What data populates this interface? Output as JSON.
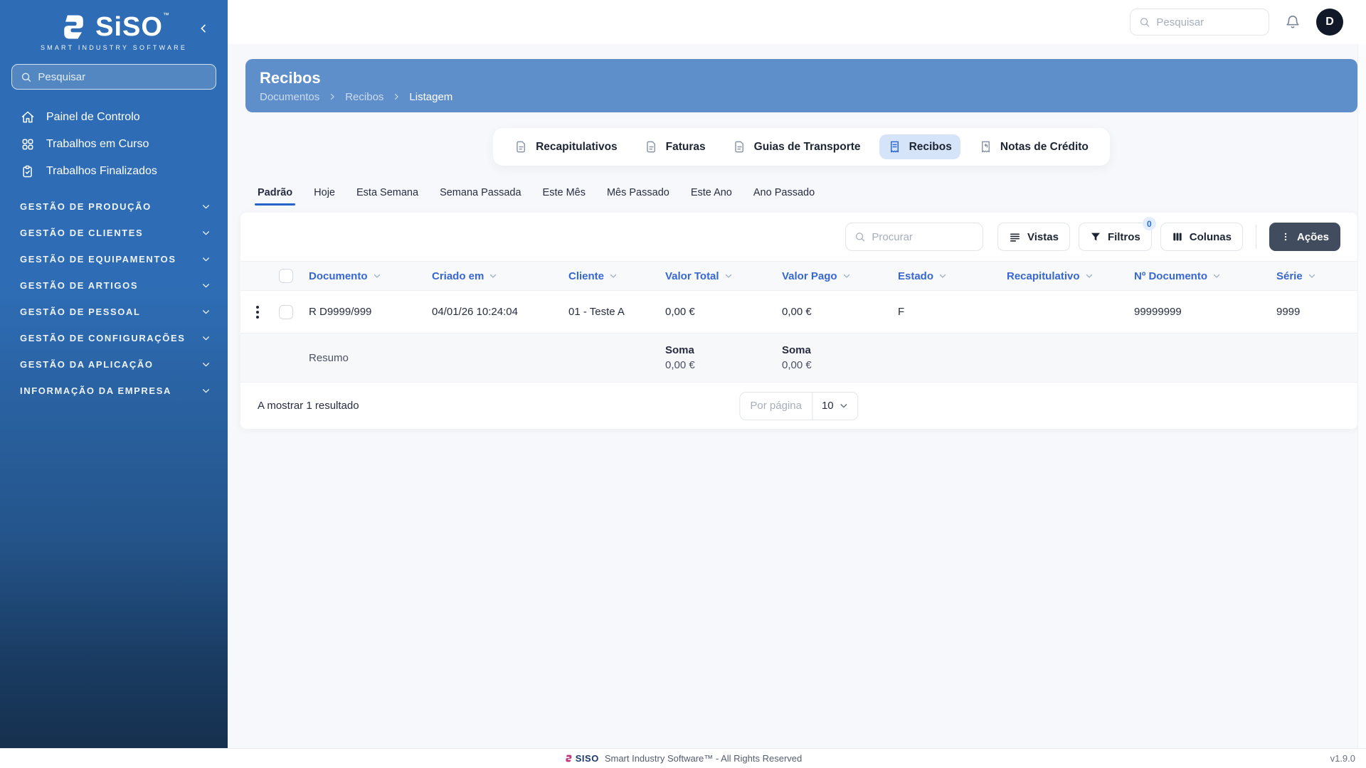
{
  "app": {
    "name": "SiSO",
    "tm": "™",
    "tagline": "SMART INDUSTRY SOFTWARE",
    "footer_brand": "SISO",
    "footer_text": "Smart Industry Software™ - All Rights Reserved",
    "version": "v1.9.0"
  },
  "colors": {
    "accent_blue": "#2f6bd0",
    "sidebar_top": "#2e6db5",
    "sidebar_bottom": "#16304e",
    "banner": "#5e8fca",
    "actions_button": "#414d5f",
    "active_tab_bg": "#d5e4f8"
  },
  "sidebar": {
    "search_placeholder": "Pesquisar",
    "items": [
      {
        "label": "Painel de Controlo",
        "icon": "home"
      },
      {
        "label": "Trabalhos em Curso",
        "icon": "grid"
      },
      {
        "label": "Trabalhos Finalizados",
        "icon": "clipboard-check"
      }
    ],
    "sections": [
      "GESTÃO DE PRODUÇÃO",
      "GESTÃO DE CLIENTES",
      "GESTÃO DE EQUIPAMENTOS",
      "GESTÃO DE ARTIGOS",
      "GESTÃO DE PESSOAL",
      "GESTÃO DE CONFIGURAÇÕES",
      "GESTÃO DA APLICAÇÃO",
      "INFORMAÇÃO DA EMPRESA"
    ]
  },
  "topbar": {
    "search_placeholder": "Pesquisar",
    "avatar_initial": "D"
  },
  "header": {
    "title": "Recibos",
    "breadcrumb": [
      "Documentos",
      "Recibos",
      "Listagem"
    ]
  },
  "doc_tabs": [
    {
      "label": "Recapitulativos",
      "active": false
    },
    {
      "label": "Faturas",
      "active": false
    },
    {
      "label": "Guias de Transporte",
      "active": false
    },
    {
      "label": "Recibos",
      "active": true
    },
    {
      "label": "Notas de Crédito",
      "active": false
    }
  ],
  "filter_tabs": [
    {
      "label": "Padrão",
      "active": true
    },
    {
      "label": "Hoje",
      "active": false
    },
    {
      "label": "Esta Semana",
      "active": false
    },
    {
      "label": "Semana Passada",
      "active": false
    },
    {
      "label": "Este Mês",
      "active": false
    },
    {
      "label": "Mês Passado",
      "active": false
    },
    {
      "label": "Este Ano",
      "active": false
    },
    {
      "label": "Ano Passado",
      "active": false
    }
  ],
  "toolbar": {
    "search_placeholder": "Procurar",
    "vistas_label": "Vistas",
    "filtros_label": "Filtros",
    "filtros_badge": "0",
    "colunas_label": "Colunas",
    "acoes_label": "Ações"
  },
  "table": {
    "columns": [
      "Documento",
      "Criado em",
      "Cliente",
      "Valor Total",
      "Valor Pago",
      "Estado",
      "Recapitulativo",
      "Nº Documento",
      "Série"
    ],
    "rows": [
      {
        "documento": "R D9999/999",
        "criado_em": "04/01/26 10:24:04",
        "cliente": "01 - Teste A",
        "valor_total": "0,00 €",
        "valor_pago": "0,00 €",
        "estado": "F",
        "recapitulativo": "",
        "n_documento": "99999999",
        "serie": "9999"
      }
    ],
    "summary": {
      "label": "Resumo",
      "sum_label": "Soma",
      "valor_total": "0,00 €",
      "valor_pago": "0,00 €"
    }
  },
  "pagination": {
    "results_text": "A mostrar 1 resultado",
    "per_page_label": "Por página",
    "per_page_value": "10"
  }
}
